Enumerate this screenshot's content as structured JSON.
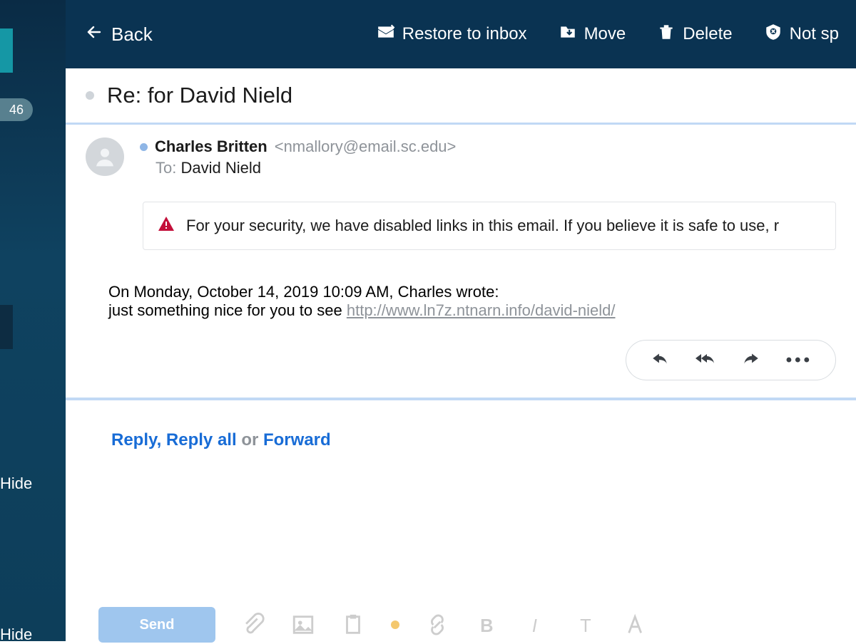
{
  "sidebar": {
    "badge_count": "46",
    "hide1": "Hide",
    "hide2": "Hide"
  },
  "topbar": {
    "back": "Back",
    "restore": "Restore to inbox",
    "move": "Move",
    "delete": "Delete",
    "not_spam": "Not sp"
  },
  "subject": "Re: for David Nield",
  "sender": {
    "name": "Charles Britten",
    "email": "<nmallory@email.sc.edu>",
    "to_label": "To:",
    "to_value": "David Nield"
  },
  "warning": "For your security, we have disabled links in this email. If you believe it is safe to use, r",
  "body": {
    "quote_header": "On Monday, October 14, 2019 10:09 AM, Charles wrote:",
    "line": "just something nice for you to see ",
    "link": "http://www.ln7z.ntnarn.info/david-nield/"
  },
  "reply_row": {
    "reply": "Reply",
    "reply_all": "Reply all",
    "or": "or",
    "forward": "Forward",
    "comma": ","
  },
  "compose": {
    "send": "Send"
  }
}
